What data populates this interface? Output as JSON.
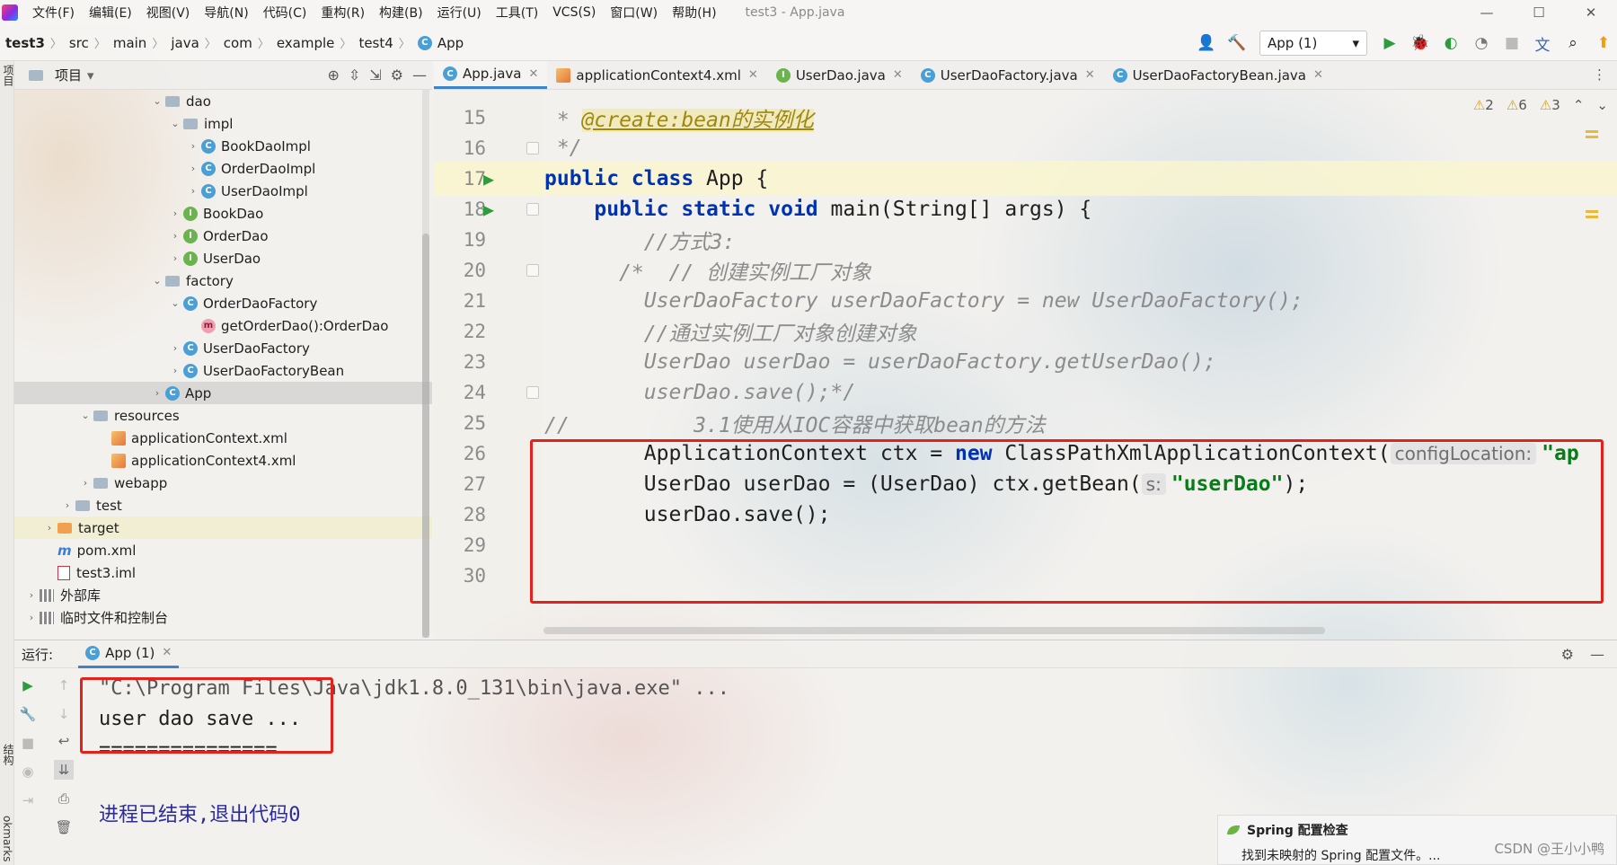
{
  "menu": {
    "items": [
      "文件(F)",
      "编辑(E)",
      "视图(V)",
      "导航(N)",
      "代码(C)",
      "重构(R)",
      "构建(B)",
      "运行(U)",
      "工具(T)",
      "VCS(S)",
      "窗口(W)",
      "帮助(H)"
    ],
    "window_title": "test3 - App.java"
  },
  "breadcrumb": [
    "test3",
    "src",
    "main",
    "java",
    "com",
    "example",
    "test4",
    "App"
  ],
  "run_config": "App (1)",
  "project_panel": {
    "title": "项目",
    "tree": [
      {
        "label": "dao",
        "indent": 8,
        "arrow": "down",
        "icon": "folder"
      },
      {
        "label": "impl",
        "indent": 9,
        "arrow": "down",
        "icon": "folder"
      },
      {
        "label": "BookDaoImpl",
        "indent": 10,
        "arrow": "right",
        "icon": "class"
      },
      {
        "label": "OrderDaoImpl",
        "indent": 10,
        "arrow": "right",
        "icon": "class"
      },
      {
        "label": "UserDaoImpl",
        "indent": 10,
        "arrow": "right",
        "icon": "class"
      },
      {
        "label": "BookDao",
        "indent": 9,
        "arrow": "right",
        "icon": "interface"
      },
      {
        "label": "OrderDao",
        "indent": 9,
        "arrow": "right",
        "icon": "interface"
      },
      {
        "label": "UserDao",
        "indent": 9,
        "arrow": "right",
        "icon": "interface"
      },
      {
        "label": "factory",
        "indent": 8,
        "arrow": "down",
        "icon": "folder"
      },
      {
        "label": "OrderDaoFactory",
        "indent": 9,
        "arrow": "down",
        "icon": "class"
      },
      {
        "label": "getOrderDao():OrderDao",
        "indent": 10,
        "arrow": "",
        "icon": "method"
      },
      {
        "label": "UserDaoFactory",
        "indent": 9,
        "arrow": "right",
        "icon": "class"
      },
      {
        "label": "UserDaoFactoryBean",
        "indent": 9,
        "arrow": "right",
        "icon": "class"
      },
      {
        "label": "App",
        "indent": 8,
        "arrow": "right",
        "icon": "class",
        "state": "selected"
      },
      {
        "label": "resources",
        "indent": 4,
        "arrow": "down",
        "icon": "folder"
      },
      {
        "label": "applicationContext.xml",
        "indent": 5,
        "arrow": "",
        "icon": "xml"
      },
      {
        "label": "applicationContext4.xml",
        "indent": 5,
        "arrow": "",
        "icon": "xml"
      },
      {
        "label": "webapp",
        "indent": 4,
        "arrow": "right",
        "icon": "folder"
      },
      {
        "label": "test",
        "indent": 3,
        "arrow": "right",
        "icon": "folder"
      },
      {
        "label": "target",
        "indent": 2,
        "arrow": "right",
        "icon": "folder-orange",
        "state": "highlight"
      },
      {
        "label": "pom.xml",
        "indent": 2,
        "arrow": "",
        "icon": "maven"
      },
      {
        "label": "test3.iml",
        "indent": 2,
        "arrow": "",
        "icon": "file"
      },
      {
        "label": "外部库",
        "indent": 1,
        "arrow": "right",
        "icon": "library"
      },
      {
        "label": "临时文件和控制台",
        "indent": 1,
        "arrow": "right",
        "icon": "scratch"
      }
    ]
  },
  "tabs": [
    {
      "label": "App.java",
      "icon": "class",
      "active": true
    },
    {
      "label": "applicationContext4.xml",
      "icon": "xml"
    },
    {
      "label": "UserDao.java",
      "icon": "interface"
    },
    {
      "label": "UserDaoFactory.java",
      "icon": "class"
    },
    {
      "label": "UserDaoFactoryBean.java",
      "icon": "class"
    }
  ],
  "inspections": {
    "warnings_a": "2",
    "warnings_b": "6",
    "warnings_c": "3"
  },
  "editor": {
    "line_numbers": [
      "15",
      "16",
      "17",
      "18",
      "19",
      "20",
      "21",
      "22",
      "23",
      "24",
      "25",
      "26",
      "27",
      "28",
      "29",
      "30"
    ],
    "l15_star": " * ",
    "l15_anno": "@create:bean的实例化",
    "l16": " */",
    "l17_kw": "public class",
    "l17_rest": " App {",
    "l18_indent": "    ",
    "l18_kw": "public static void",
    "l18_rest": " main(String[] args) {",
    "l19": "        //方式3:",
    "l20": "      /*  // 创建实例工厂对象",
    "l21": "        UserDaoFactory userDaoFactory = new UserDaoFactory();",
    "l22": "        //通过实例工厂对象创建对象",
    "l23": "        UserDao userDao = userDaoFactory.getUserDao();",
    "l24": "        userDao.save();*/",
    "l25": "//          3.1使用从IOC容器中获取bean的方法",
    "l26_a": "        ApplicationContext ctx = ",
    "l26_kw": "new",
    "l26_b": " ClassPathXmlApplicationContext(",
    "l26_hint": "configLocation:",
    "l26_str": "\"ap",
    "l27_a": "        UserDao userDao = (UserDao) ctx.getBean(",
    "l27_hint": "s:",
    "l27_str": "\"userDao\"",
    "l27_b": ");",
    "l28": "        userDao.save();"
  },
  "run_panel": {
    "label": "运行:",
    "tab": "App (1)",
    "console": [
      "\"C:\\Program Files\\Java\\jdk1.8.0_131\\bin\\java.exe\" ...",
      "user dao save ...",
      "===============",
      "进程已结束,退出代码0"
    ]
  },
  "left_strip": {
    "project": "项目",
    "structure": "结构",
    "bookmarks": "okmarks"
  },
  "notification": {
    "title": "Spring 配置检查",
    "body": "找到未映射的 Spring 配置文件。..."
  },
  "watermark": "CSDN @王小小鸭",
  "colors": {
    "accent": "#4083c9",
    "annotation_box": "#e5211d",
    "keyword": "#0033b3",
    "string": "#067d17",
    "comment": "#8c8c8c"
  }
}
